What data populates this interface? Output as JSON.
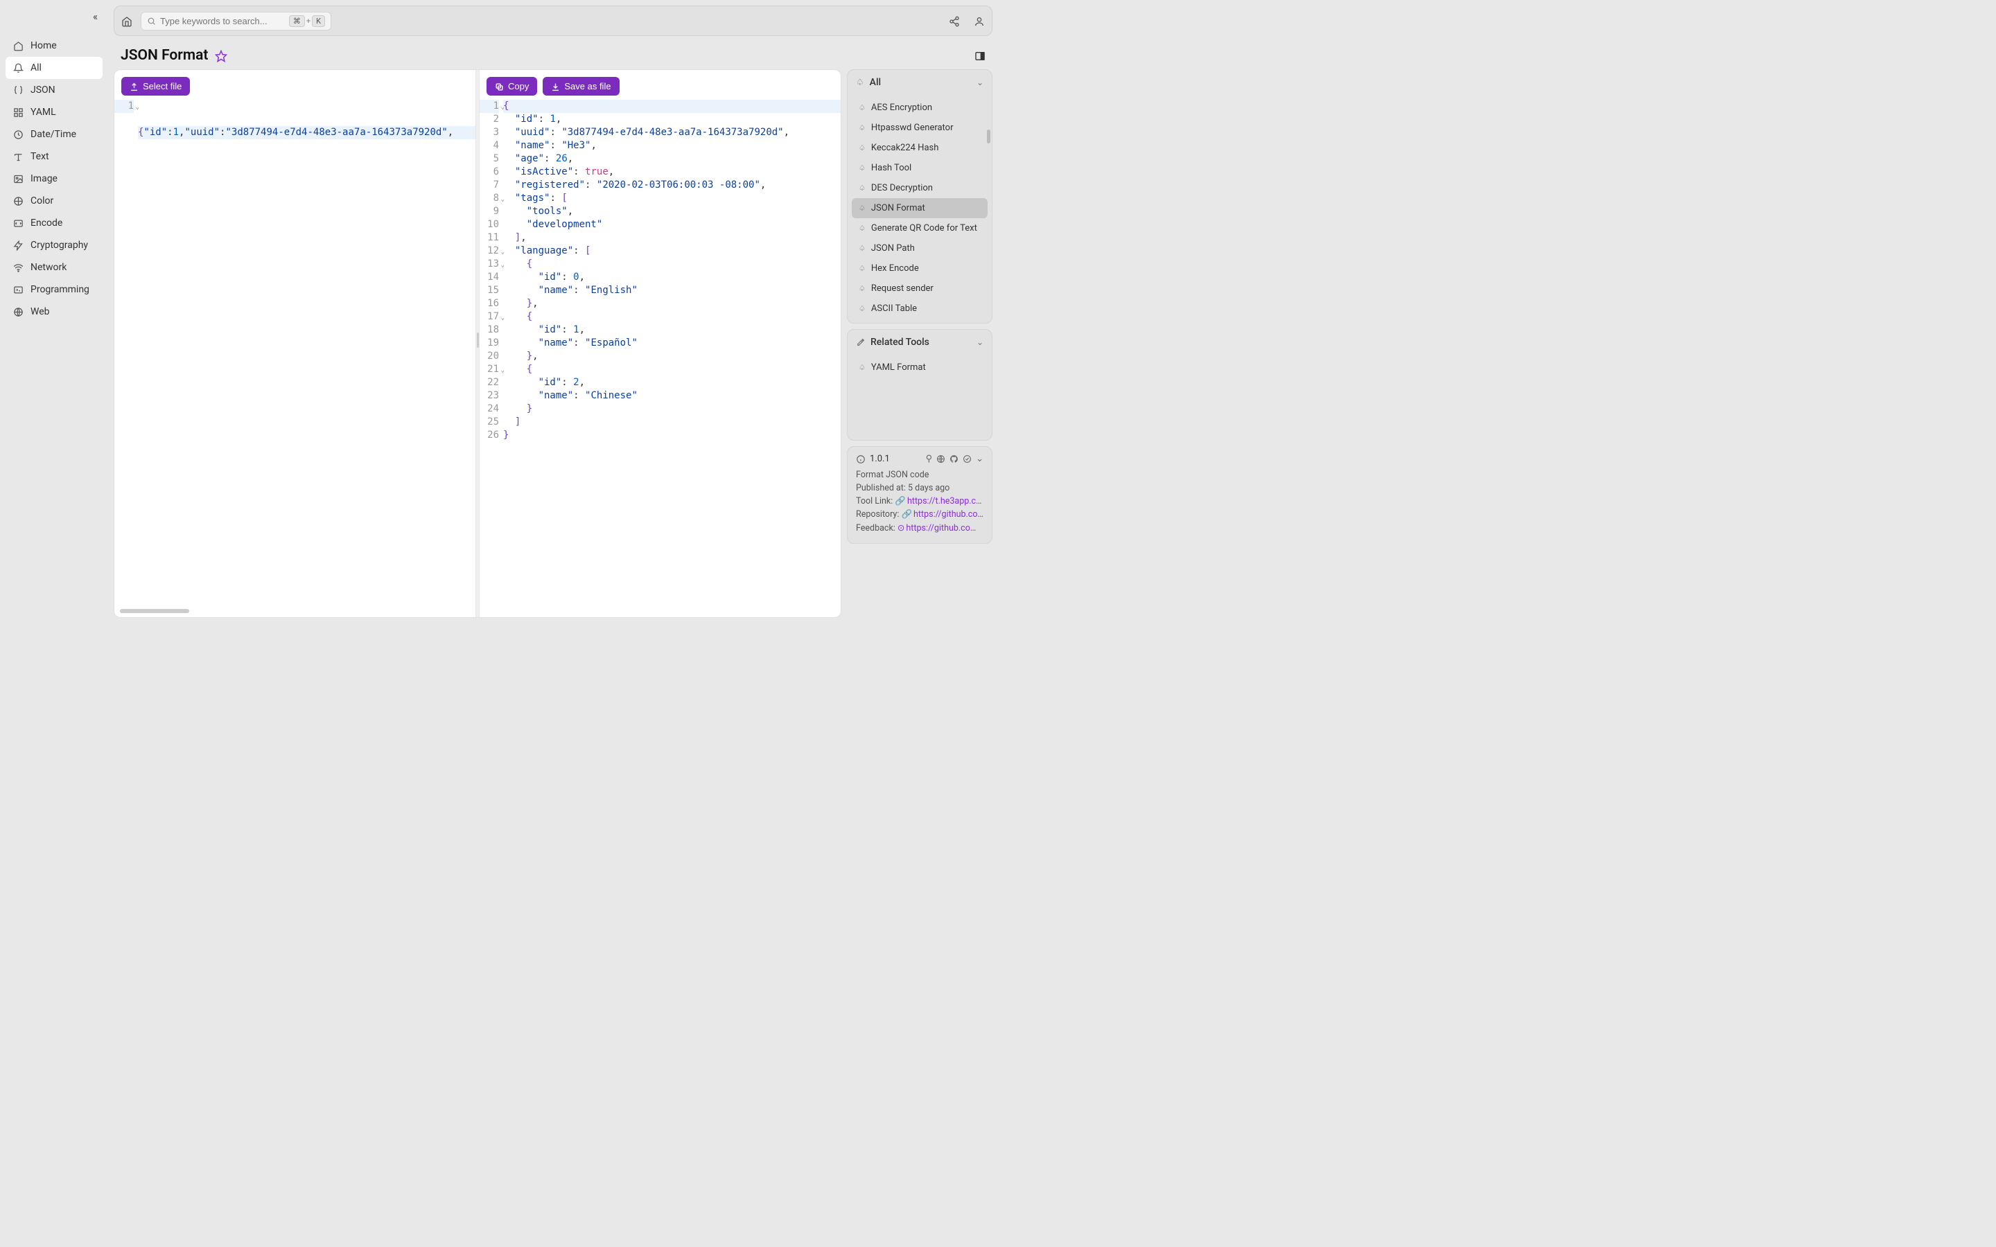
{
  "sidebar": {
    "items": [
      {
        "icon": "home",
        "label": "Home"
      },
      {
        "icon": "bell",
        "label": "All",
        "active": true
      },
      {
        "icon": "json",
        "label": "JSON"
      },
      {
        "icon": "grid",
        "label": "YAML"
      },
      {
        "icon": "clock",
        "label": "Date/Time"
      },
      {
        "icon": "text",
        "label": "Text"
      },
      {
        "icon": "image",
        "label": "Image"
      },
      {
        "icon": "color",
        "label": "Color"
      },
      {
        "icon": "encode",
        "label": "Encode"
      },
      {
        "icon": "crypto",
        "label": "Cryptography"
      },
      {
        "icon": "network",
        "label": "Network"
      },
      {
        "icon": "code",
        "label": "Programming"
      },
      {
        "icon": "web",
        "label": "Web"
      }
    ]
  },
  "topbar": {
    "search_placeholder": "Type keywords to search...",
    "kbd1": "⌘",
    "kbd_plus": "+",
    "kbd2": "K"
  },
  "page": {
    "title": "JSON Format"
  },
  "editor": {
    "left": {
      "select_file": "Select file",
      "raw": "{\"id\":1,\"uuid\":\"3d877494-e7d4-48e3-aa7a-164373a7920d\","
    },
    "right": {
      "copy": "Copy",
      "save_as_file": "Save as file",
      "lines": [
        "{",
        "  \"id\": 1,",
        "  \"uuid\": \"3d877494-e7d4-48e3-aa7a-164373a7920d\",",
        "  \"name\": \"He3\",",
        "  \"age\": 26,",
        "  \"isActive\": true,",
        "  \"registered\": \"2020-02-03T06:00:03 -08:00\",",
        "  \"tags\": [",
        "    \"tools\",",
        "    \"development\"",
        "  ],",
        "  \"language\": [",
        "    {",
        "      \"id\": 0,",
        "      \"name\": \"English\"",
        "    },",
        "    {",
        "      \"id\": 1,",
        "      \"name\": \"Español\"",
        "    },",
        "    {",
        "      \"id\": 2,",
        "      \"name\": \"Chinese\"",
        "    }",
        "  ]",
        "}"
      ]
    }
  },
  "rail": {
    "all": {
      "title": "All",
      "items": [
        "AES Encryption",
        "Htpasswd Generator",
        "Keccak224 Hash",
        "Hash Tool",
        "DES Decryption",
        "JSON Format",
        "Generate QR Code for Text",
        "JSON Path",
        "Hex Encode",
        "Request sender",
        "ASCII Table"
      ],
      "active_index": 5
    },
    "related": {
      "title": "Related Tools",
      "items": [
        "YAML Format"
      ]
    }
  },
  "info": {
    "version": "1.0.1",
    "desc": "Format JSON code",
    "published_label": "Published at:",
    "published_value": "5 days ago",
    "tool_link_label": "Tool Link:",
    "tool_link_value": "https://t.he3app.co…",
    "repo_label": "Repository:",
    "repo_value": "https://github.com/…",
    "feedback_label": "Feedback:",
    "feedback_value": "https://github.com/…"
  }
}
